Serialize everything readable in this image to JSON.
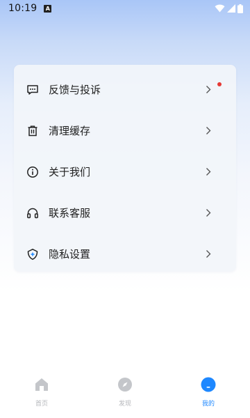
{
  "status_bar": {
    "time": "10:19",
    "notification_glyph": "A",
    "icons": [
      "wifi-icon",
      "signal-icon",
      "battery-icon"
    ]
  },
  "menu": {
    "items": [
      {
        "label": "反馈与投诉",
        "icon": "feedback-icon",
        "has_badge": true
      },
      {
        "label": "清理缓存",
        "icon": "trash-icon",
        "has_badge": false
      },
      {
        "label": "关于我们",
        "icon": "info-icon",
        "has_badge": false
      },
      {
        "label": "联系客服",
        "icon": "headphones-icon",
        "has_badge": false
      },
      {
        "label": "隐私设置",
        "icon": "shield-icon",
        "has_badge": false
      }
    ]
  },
  "tabbar": {
    "tabs": [
      {
        "label": "首页",
        "icon": "home-icon",
        "active": false
      },
      {
        "label": "发现",
        "icon": "compass-icon",
        "active": false
      },
      {
        "label": "我的",
        "icon": "profile-icon",
        "active": true
      }
    ]
  },
  "colors": {
    "accent": "#1e88ff",
    "badge": "#e53935",
    "inactive_tab": "#b5b7bb",
    "card_bg": "#f2f5fa"
  }
}
